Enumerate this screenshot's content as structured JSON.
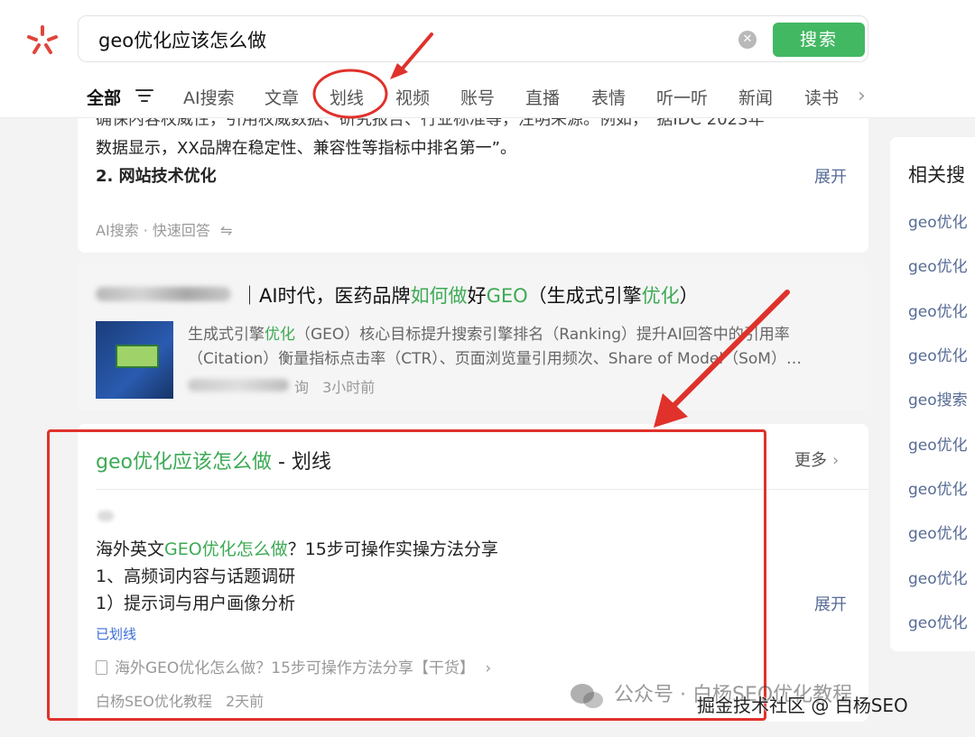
{
  "search": {
    "query": "geo优化应该怎么做",
    "button_label": "搜索"
  },
  "tabs": [
    {
      "label": "全部",
      "active": true
    },
    {
      "label": "AI搜索"
    },
    {
      "label": "文章"
    },
    {
      "label": "划线"
    },
    {
      "label": "视频"
    },
    {
      "label": "账号"
    },
    {
      "label": "直播"
    },
    {
      "label": "表情"
    },
    {
      "label": "听一听"
    },
    {
      "label": "新闻"
    },
    {
      "label": "读书"
    }
  ],
  "ai_card": {
    "partial_top": "确保内容权威性，引用权威数据、研究报告、行业标准等，注明来源。例如，“据IDC 2023年",
    "line2": "数据显示，XX品牌在稳定性、兼容性等指标中排名第一”。",
    "heading": "2. 网站技术优化",
    "expand": "展开",
    "footer": "AI搜索 · 快速回答",
    "footer_icon": "⇋"
  },
  "article_card": {
    "title_prefix": "｜AI时代，医药品牌",
    "title_hl1": "如何做",
    "title_mid": "好",
    "title_hl2": "GEO",
    "title_mid2": "（生成式引擎",
    "title_hl3": "优化",
    "title_end": "）",
    "summary1_a": "生成式引擎",
    "summary1_hl": "优化",
    "summary1_b": "（GEO）核心目标提升搜索引擎排名（Ranking）提升AI回答中的引用率",
    "summary2": "（Citation）衡量指标点击率（CTR）、页面浏览量引用频次、Share of Model（SoM）…",
    "author_suffix": "询",
    "time": "3小时前"
  },
  "huaxian": {
    "title_hl": "geo优化应该怎么做",
    "title_rest": " - 划线",
    "more": "更多",
    "line1_a": "海外英文",
    "line1_hl": "GEO优化怎么做",
    "line1_b": "？15步可操作实操方法分享",
    "line2": "1、高频词内容与话题调研",
    "line3": "1）提示词与用户画像分析",
    "expand": "展开",
    "marked_label": "已划线",
    "source": "海外GEO优化怎么做？15步可操作方法分享【干货】",
    "source_arrow": "›",
    "author": "白杨SEO优化教程",
    "time": "2天前"
  },
  "related": {
    "title": "相关搜",
    "items": [
      "geo优化",
      "geo优化",
      "geo优化",
      "geo优化",
      "geo搜索",
      "geo优化",
      "geo优化",
      "geo优化",
      "geo优化",
      "geo优化"
    ]
  },
  "watermark": {
    "main": "公众号 · 白杨SEO优化教程",
    "sub": "掘金技术社区 @ 白杨SEO"
  },
  "colors": {
    "accent_green": "#42b862",
    "highlight_green": "#3daa55",
    "link_blue": "#576b95",
    "annotation_red": "#e0312b"
  }
}
